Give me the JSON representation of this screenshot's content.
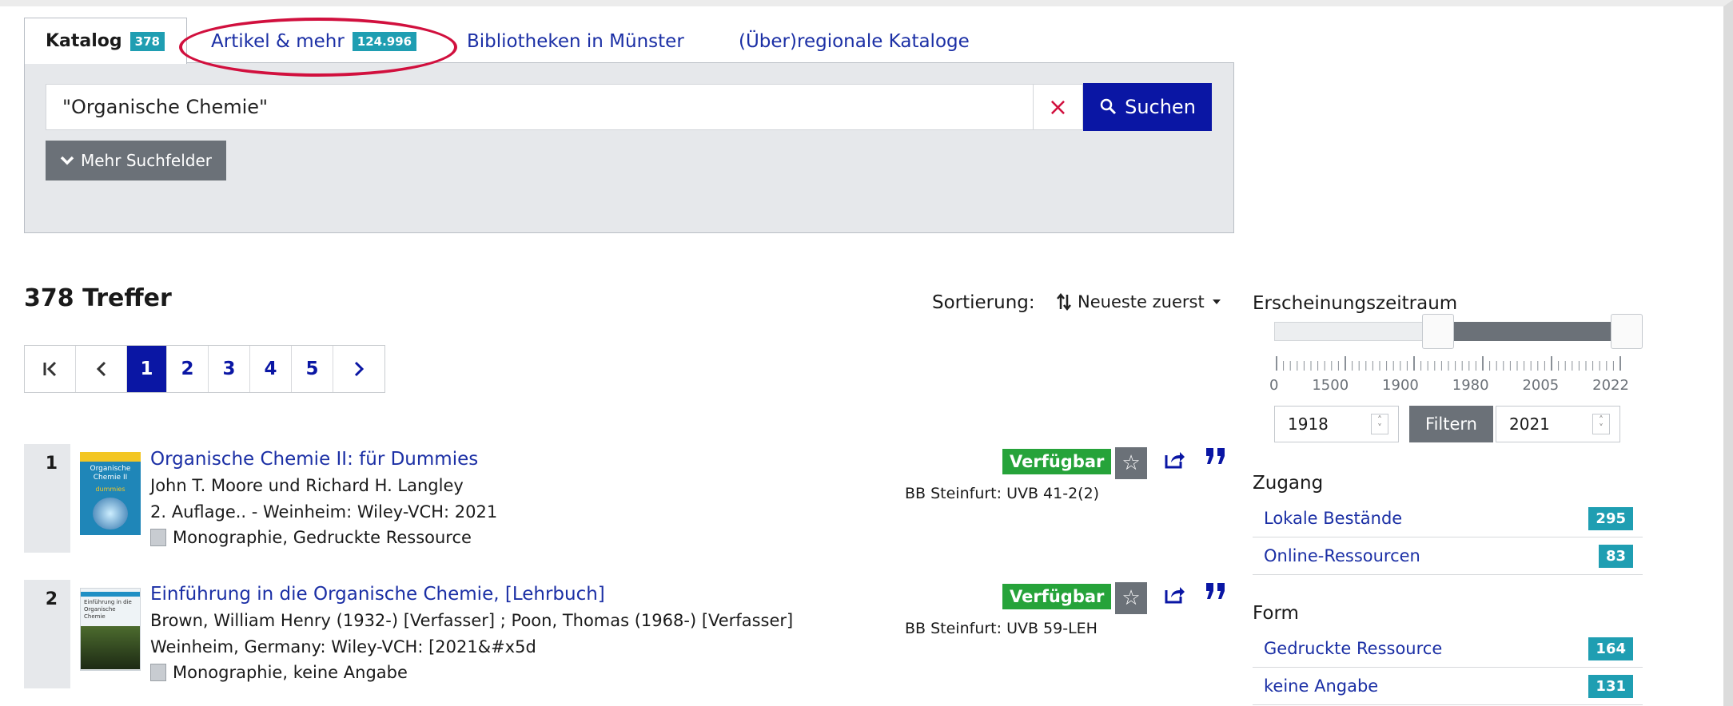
{
  "tabs": {
    "catalog": {
      "label": "Katalog",
      "count": "378"
    },
    "articles": {
      "label": "Artikel & mehr",
      "count": "124.996"
    },
    "libraries": {
      "label": "Bibliotheken in Münster"
    },
    "regional": {
      "label": "(Über)regionale Kataloge"
    }
  },
  "search": {
    "query": "\"Organische Chemie\"",
    "clear_icon": "×",
    "button_label": "Suchen",
    "more_fields_label": "Mehr Suchfelder"
  },
  "results_header": {
    "hits": "378 Treffer",
    "sort_label": "Sortierung:",
    "sort_value": "Neueste zuerst"
  },
  "pagination": {
    "first": "|<",
    "prev": "<",
    "pages": [
      "1",
      "2",
      "3",
      "4",
      "5"
    ],
    "next": ">",
    "current": "1"
  },
  "results": [
    {
      "number": "1",
      "title": "Organische Chemie II: für Dummies",
      "authors": "John T. Moore und Richard H. Langley",
      "edition": "2. Auflage.. - Weinheim: Wiley-VCH: 2021",
      "type": "Monographie, Gedruckte Ressource",
      "availability": "Verfügbar",
      "location": "BB Steinfurt: UVB 41-2(2)",
      "cover_text": "Organische Chemie II",
      "cover_sub": "dummies"
    },
    {
      "number": "2",
      "title": "Einführung in die Organische Chemie, [Lehrbuch]",
      "authors": "Brown, William Henry (1932-) [Verfasser] ; Poon, Thomas (1968-) [Verfasser]",
      "edition": "Weinheim, Germany: Wiley-VCH: [2021&#x5d",
      "type": "Monographie, keine Angabe",
      "availability": "Verfügbar",
      "location": "BB Steinfurt: UVB 59-LEH",
      "cover_text": "Einführung in die Organische Chemie"
    }
  ],
  "facets": {
    "period": {
      "title": "Erscheinungszeitraum",
      "tick_labels": [
        "0",
        "1500",
        "1900",
        "1980",
        "2005",
        "2022"
      ],
      "from": "1918",
      "to": "2021",
      "filter_label": "Filtern",
      "slider_range_fraction": [
        0.45,
        0.97
      ]
    },
    "access": {
      "title": "Zugang",
      "items": [
        {
          "label": "Lokale Bestände",
          "count": "295"
        },
        {
          "label": "Online-Ressourcen",
          "count": "83"
        }
      ]
    },
    "form": {
      "title": "Form",
      "items": [
        {
          "label": "Gedruckte Ressource",
          "count": "164"
        },
        {
          "label": "keine Angabe",
          "count": "131"
        }
      ]
    }
  },
  "colors": {
    "primary": "#0a16a4",
    "teal": "#1f9eb2",
    "available": "#26a33a",
    "highlight": "#d1103e",
    "grey_button": "#6b7178"
  }
}
